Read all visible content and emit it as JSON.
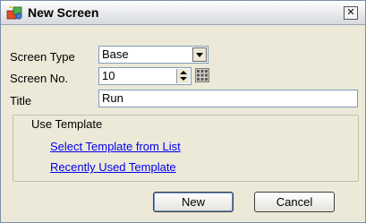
{
  "window": {
    "title": "New Screen",
    "title_icon": "new-screen-app-icon",
    "close_symbol": "✕"
  },
  "form": {
    "screen_type_label": "Screen Type",
    "screen_type_value": "Base",
    "screen_no_label": "Screen No.",
    "screen_no_value": "10",
    "title_label": "Title",
    "title_value": "Run"
  },
  "template": {
    "group_label": "Use Template",
    "select_link": "Select Template from List",
    "recent_link": "Recently Used Template"
  },
  "buttons": {
    "new_label": "New",
    "cancel_label": "Cancel"
  },
  "colors": {
    "link": "#0000ee",
    "dialog_bg": "#ece9d8"
  }
}
